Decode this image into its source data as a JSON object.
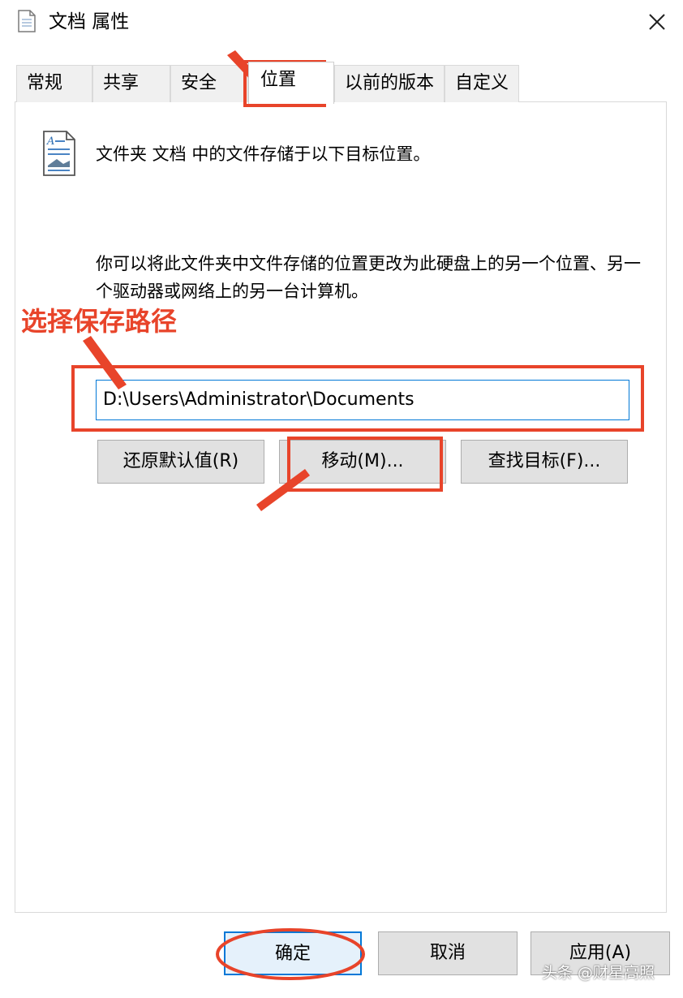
{
  "window": {
    "title": "文档 属性",
    "close_icon": "close-icon"
  },
  "tabs": [
    {
      "label": "常规"
    },
    {
      "label": "共享"
    },
    {
      "label": "安全"
    },
    {
      "label": "位置"
    },
    {
      "label": "以前的版本"
    },
    {
      "label": "自定义"
    }
  ],
  "active_tab": "位置",
  "content": {
    "info_text": "文件夹 文档 中的文件存储于以下目标位置。",
    "description": "你可以将此文件夹中文件存储的位置更改为此硬盘上的另一个位置、另一个驱动器或网络上的另一台计算机。",
    "path_value": "D:\\Users\\Administrator\\Documents",
    "restore_button": "还原默认值(R)",
    "move_button": "移动(M)...",
    "find_target_button": "查找目标(F)..."
  },
  "footer": {
    "ok_button": "确定",
    "cancel_button": "取消",
    "apply_button": "应用(A)"
  },
  "annotation": {
    "label": "选择保存路径",
    "color": "#e8442a"
  },
  "watermark": "头条 @财星高照"
}
